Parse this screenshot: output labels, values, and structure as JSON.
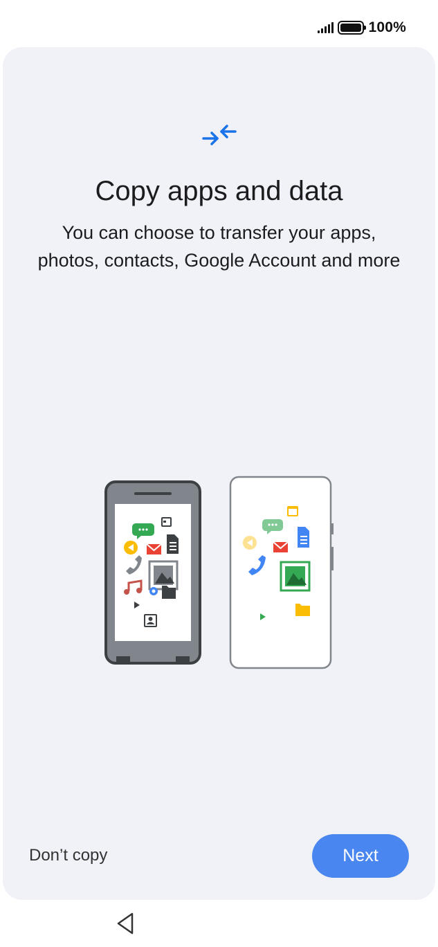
{
  "status_bar": {
    "battery_text": "100%",
    "signal_icon": "signal-bars-icon",
    "battery_icon": "battery-icon"
  },
  "main": {
    "icon": "transfer-arrows-icon",
    "title": "Copy apps and data",
    "subtitle": "You can choose to transfer your apps, photos, contacts, Google Account and more",
    "illustration": "phones-transfer-illustration"
  },
  "footer": {
    "dont_copy_label": "Don’t copy",
    "next_label": "Next"
  },
  "nav_bar": {
    "back_icon": "back-triangle-icon"
  },
  "colors": {
    "accent": "#4a86f0",
    "card_background": "#f0f2f7",
    "icon_blue": "#1a73e8"
  }
}
